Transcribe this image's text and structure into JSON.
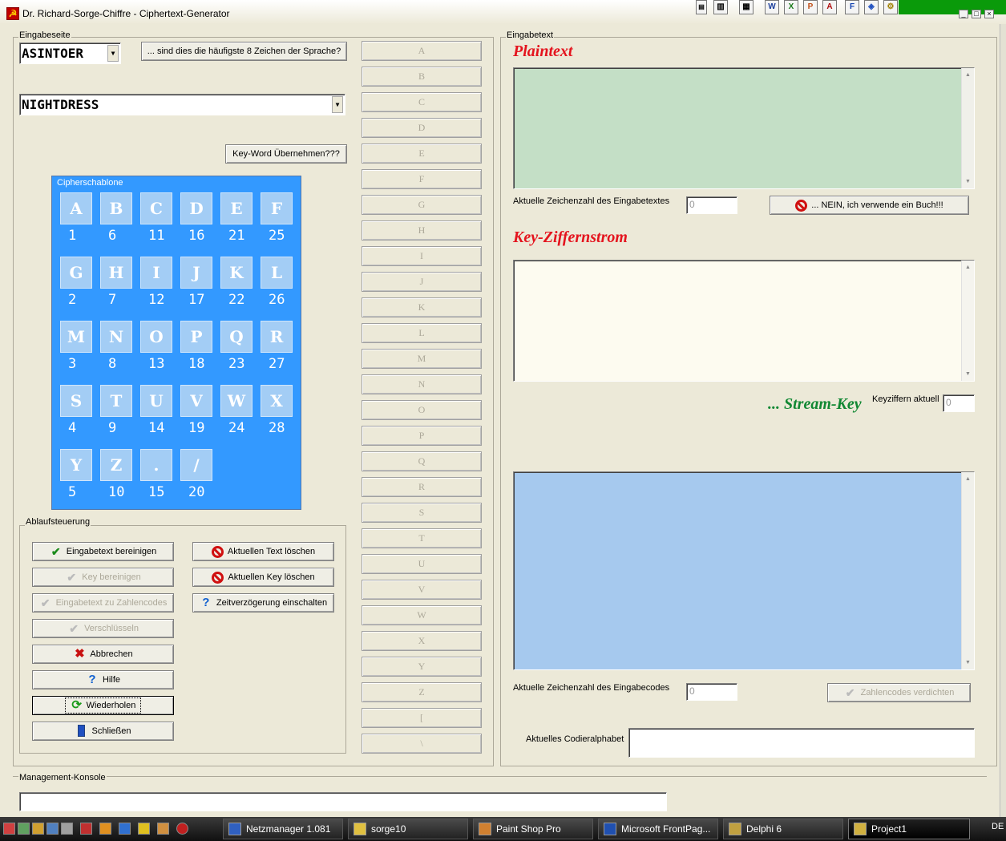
{
  "window": {
    "title": "Dr. Richard-Sorge-Chiffre - Ciphertext-Generator"
  },
  "eingabeseite": {
    "group_label": "Eingabeseite",
    "combo_top_value": "ASINTOER",
    "frequency_button": "... sind dies die häufigste 8 Zeichen der Sprache?",
    "combo_keyword_value": "NIGHTDRESS",
    "keyword_button": "Key-Word Übernehmen???"
  },
  "cipher": {
    "label": "Cipherschablone",
    "cells": [
      {
        "letter": "A",
        "num": "1"
      },
      {
        "letter": "B",
        "num": "6"
      },
      {
        "letter": "C",
        "num": "11"
      },
      {
        "letter": "D",
        "num": "16"
      },
      {
        "letter": "E",
        "num": "21"
      },
      {
        "letter": "F",
        "num": "25"
      },
      {
        "letter": "G",
        "num": "2"
      },
      {
        "letter": "H",
        "num": "7"
      },
      {
        "letter": "I",
        "num": "12"
      },
      {
        "letter": "J",
        "num": "17"
      },
      {
        "letter": "K",
        "num": "22"
      },
      {
        "letter": "L",
        "num": "26"
      },
      {
        "letter": "M",
        "num": "3"
      },
      {
        "letter": "N",
        "num": "8"
      },
      {
        "letter": "O",
        "num": "13"
      },
      {
        "letter": "P",
        "num": "18"
      },
      {
        "letter": "Q",
        "num": "23"
      },
      {
        "letter": "R",
        "num": "27"
      },
      {
        "letter": "S",
        "num": "4"
      },
      {
        "letter": "T",
        "num": "9"
      },
      {
        "letter": "U",
        "num": "14"
      },
      {
        "letter": "V",
        "num": "19"
      },
      {
        "letter": "W",
        "num": "24"
      },
      {
        "letter": "X",
        "num": "28"
      },
      {
        "letter": "Y",
        "num": "5"
      },
      {
        "letter": "Z",
        "num": "10"
      },
      {
        "letter": ".",
        "num": "15"
      },
      {
        "letter": "/",
        "num": "20"
      }
    ]
  },
  "ablauf": {
    "group_label": "Ablaufsteuerung",
    "btn_eingabetext_bereinigen": "Eingabetext bereinigen",
    "btn_key_bereinigen": "Key bereinigen",
    "btn_zahlencodes": "Eingabetext zu Zahlencodes",
    "btn_verschluesseln": "Verschlüsseln",
    "btn_abbrechen": "Abbrechen",
    "btn_hilfe": "Hilfe",
    "btn_wiederholen": "Wiederholen",
    "btn_schliessen": "Schließen",
    "btn_text_loeschen": "Aktuellen Text löschen",
    "btn_key_loeschen": "Aktuellen Key löschen",
    "btn_zeitverzoegerung": "Zeitverzögerung einschalten"
  },
  "letter_buttons": [
    "A",
    "B",
    "C",
    "D",
    "E",
    "F",
    "G",
    "H",
    "I",
    "J",
    "K",
    "L",
    "M",
    "N",
    "O",
    "P",
    "Q",
    "R",
    "S",
    "T",
    "U",
    "V",
    "W",
    "X",
    "Y",
    "Z",
    "[",
    "\\"
  ],
  "eingabetext": {
    "group_label": "Eingabetext",
    "plaintext_heading": "Plaintext",
    "zeichenzahl_label": "Aktuelle Zeichenzahl des Eingabetextes",
    "zeichenzahl_value": "0",
    "buch_button": "... NEIN, ich verwende ein Buch!!!",
    "key_heading": "Key-Ziffernstrom",
    "stream_heading": "... Stream-Key",
    "keyziffern_label": "Keyziffern aktuell",
    "keyziffern_value": "0",
    "codes_label": "Aktuelle Zeichenzahl des Eingabecodes",
    "codes_value": "0",
    "verdichten_button": "Zahlencodes verdichten",
    "alphabet_label": "Aktuelles Codieralphabet",
    "alphabet_value": ""
  },
  "management": {
    "group_label": "Management-Konsole",
    "console_value": ""
  },
  "taskbar": {
    "items": [
      "Netzmanager 1.081",
      "sorge10",
      "Paint Shop Pro",
      "Microsoft FrontPag...",
      "Delphi 6",
      "Project1"
    ],
    "locale": "DE"
  },
  "colors": {
    "plaintext_bg": "#c4dfc6",
    "key_bg": "#fdfbf0",
    "stream_bg": "#a6c9ee",
    "cipher_bg": "#3399ff",
    "heading_red": "#e4141e",
    "heading_green": "#118833"
  }
}
